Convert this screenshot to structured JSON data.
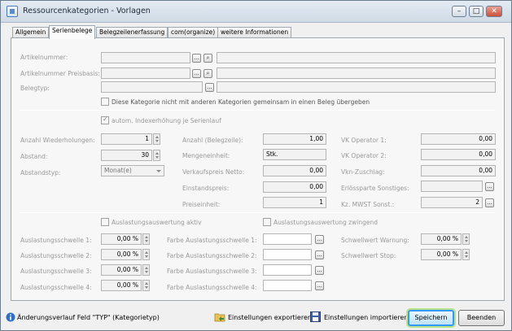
{
  "window": {
    "title": "Ressourcenkategorien - Vorlagen",
    "minimize": "–",
    "maximize": "□",
    "close": "✕"
  },
  "tabs": [
    "Allgemein",
    "Serienbelege",
    "Belegzeilenerfassung",
    "com(organize)",
    "weitere Informationen"
  ],
  "top": {
    "artikelnummer_label": "Artikelnummer:",
    "artikelnummer_preisbasis_label": "Artikelnummer Preisbasis:",
    "belegtyp_label": "Belegtyp:",
    "browse_label": "...",
    "lookup_label": "⌕",
    "separate_checkbox_label": "Diese Kategorie nicht mit anderen Kategorien gemeinsam in einen Beleg übergeben"
  },
  "series": {
    "auto_index_label": "autom. Indexerhöhung je Serienlauf",
    "anzahl_wiederholungen_label": "Anzahl Wiederholungen:",
    "anzahl_wiederholungen_value": "1",
    "abstand_label": "Abstand:",
    "abstand_value": "30",
    "abstandstyp_label": "Abstandstyp:",
    "abstandstyp_value": "Monat(e)",
    "anzahl_belegzeile_label": "Anzahl (Belegzeile):",
    "anzahl_belegzeile_value": "1,00",
    "mengeneinheit_label": "Mengeneinheit:",
    "mengeneinheit_value": "Stk.",
    "verkaufspreis_label": "Verkaufspreis Netto:",
    "verkaufspreis_value": "0,00",
    "einstandspreis_label": "Einstandspreis:",
    "einstandspreis_value": "0,00",
    "preiseinheit_label": "Preiseinheit:",
    "preiseinheit_value": "1",
    "vk_op1_label": "VK Operator 1:",
    "vk_op1_value": "0,00",
    "vk_op2_label": "VK Operator 2:",
    "vk_op2_value": "0,00",
    "vkn_zuschlag_label": "Vkn-Zuschlag:",
    "vkn_zuschlag_value": "0,00",
    "erloessparte_label": "Erlössparte Sonstiges:",
    "kz_mwst_label": "Kz. MWST Sonst.:",
    "kz_mwst_value": "2"
  },
  "utilization": {
    "aktiv_label": "Auslastungsauswertung aktiv",
    "zwingend_label": "Auslastungsauswertung zwingend",
    "schwellen": [
      {
        "label": "Auslastungsschwelle 1:",
        "value": "0,00 %",
        "color_label": "Farbe Auslastungsschwelle 1:"
      },
      {
        "label": "Auslastungsschwelle 2:",
        "value": "0,00 %",
        "color_label": "Farbe Auslastungsschwelle 2:"
      },
      {
        "label": "Auslastungsschwelle 3:",
        "value": "0,00 %",
        "color_label": "Farbe Auslastungsschwelle 3:"
      },
      {
        "label": "Auslastungsschwelle 4:",
        "value": "0,00 %",
        "color_label": "Farbe Auslastungsschwelle 4:"
      }
    ],
    "warnung_label": "Schwellwert Warnung:",
    "warnung_value": "0,00 %",
    "stop_label": "Schwellwert Stop:",
    "stop_value": "0,00 %"
  },
  "footer": {
    "history_text": "Änderungsverlauf Feld \"TYP\" (Kategorietyp)",
    "export_label": "Einstellungen exportieren",
    "import_label": "Einstellungen importieren",
    "save_label": "Speichern",
    "close_label": "Beenden"
  },
  "colors": {
    "label_gray": "#999999",
    "focus_blue": "#3399ff",
    "focus_green": "#b6e38a"
  }
}
